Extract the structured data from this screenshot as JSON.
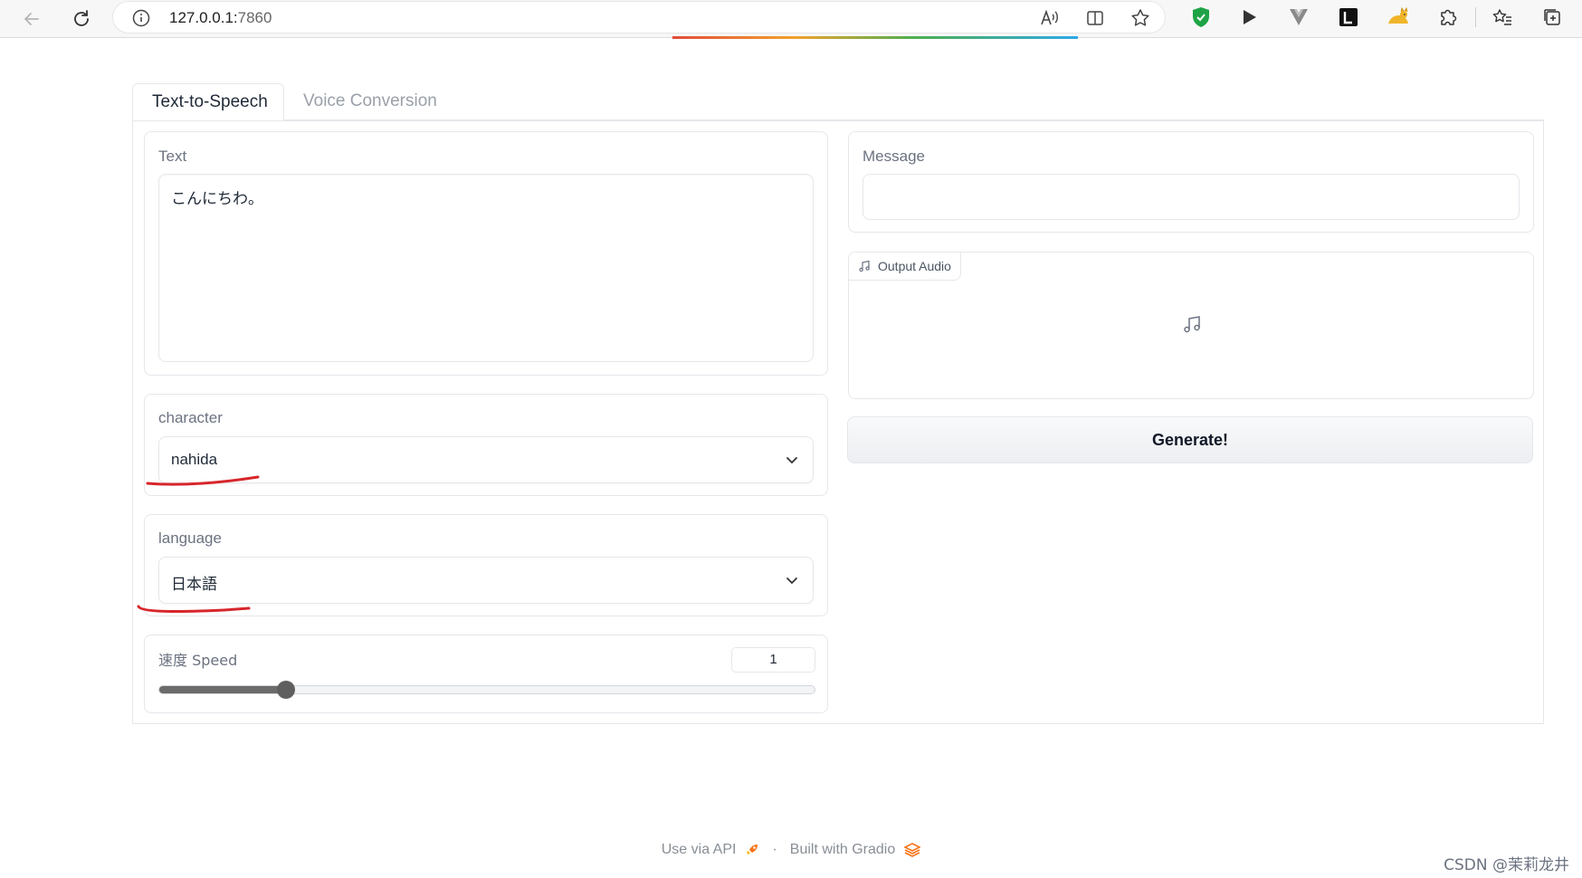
{
  "browser": {
    "url_host": "127.0.0.1:",
    "url_port": "7860"
  },
  "tabs": [
    {
      "label": "Text-to-Speech",
      "active": true
    },
    {
      "label": "Voice Conversion",
      "active": false
    }
  ],
  "text_block": {
    "label": "Text",
    "value": "こんにちわ。"
  },
  "character_block": {
    "label": "character",
    "value": "nahida"
  },
  "language_block": {
    "label": "language",
    "value": "日本語"
  },
  "speed_block": {
    "label": "速度 Speed",
    "value": "1",
    "fraction": 0.194
  },
  "message_block": {
    "label": "Message",
    "value": ""
  },
  "audio_block": {
    "label": "Output Audio"
  },
  "generate_button": {
    "label": "Generate!"
  },
  "footer": {
    "api_label": "Use via API",
    "separator": "·",
    "built_label": "Built with Gradio"
  },
  "watermark": "CSDN @茉莉龙井",
  "colors": {
    "annotation_red": "#d7262b",
    "slider": "#5f5f5f"
  }
}
